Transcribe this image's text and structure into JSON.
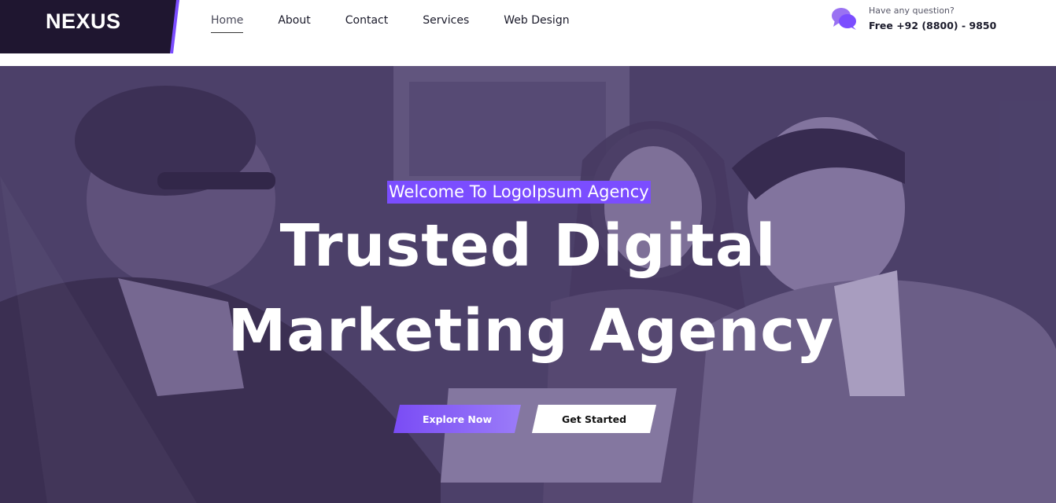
{
  "brand": {
    "name": "NEXUS",
    "colors": {
      "dark": "#1f1630",
      "accent": "#7b4dff",
      "white": "#ffffff"
    }
  },
  "nav": {
    "items": [
      {
        "label": "Home",
        "active": true
      },
      {
        "label": "About",
        "active": false
      },
      {
        "label": "Contact",
        "active": false
      },
      {
        "label": "Services",
        "active": false
      },
      {
        "label": "Web Design",
        "active": false
      }
    ]
  },
  "contact": {
    "icon": "chat-bubbles-icon",
    "question": "Have any question?",
    "phone": "Free +92 (8800) - 9850"
  },
  "hero": {
    "background": "photo-of-three-people-in-meeting",
    "welcome": "Welcome To LogoIpsum Agency",
    "headline_line1": "Trusted Digital",
    "headline_line2": "Marketing Agency",
    "buttons": {
      "explore": "Explore Now",
      "start": "Get Started"
    }
  }
}
